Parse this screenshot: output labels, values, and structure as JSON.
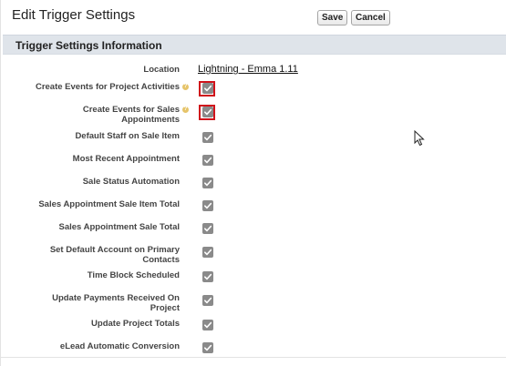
{
  "header": {
    "title": "Edit Trigger Settings",
    "save_label": "Save",
    "cancel_label": "Cancel"
  },
  "section": {
    "title": "Trigger Settings Information"
  },
  "location": {
    "label": "Location",
    "value": "Lightning - Emma 1.11"
  },
  "settings": [
    {
      "line1": "Create Events for Project Activities",
      "line2": "",
      "checked": true,
      "help": true,
      "highlighted": true
    },
    {
      "line1": "Create Events for Sales",
      "line2": "Appointments",
      "checked": true,
      "help": true,
      "highlighted": true
    },
    {
      "line1": "Default Staff on Sale Item",
      "line2": "",
      "checked": true,
      "help": false,
      "highlighted": false
    },
    {
      "line1": "Most Recent Appointment",
      "line2": "",
      "checked": true,
      "help": false,
      "highlighted": false
    },
    {
      "line1": "Sale Status Automation",
      "line2": "",
      "checked": true,
      "help": false,
      "highlighted": false
    },
    {
      "line1": "Sales Appointment Sale Item Total",
      "line2": "",
      "checked": true,
      "help": false,
      "highlighted": false
    },
    {
      "line1": "Sales Appointment Sale Total",
      "line2": "",
      "checked": true,
      "help": false,
      "highlighted": false
    },
    {
      "line1": "Set Default Account on Primary",
      "line2": "Contacts",
      "checked": true,
      "help": false,
      "highlighted": false
    },
    {
      "line1": "Time Block Scheduled",
      "line2": "",
      "checked": true,
      "help": false,
      "highlighted": false
    },
    {
      "line1": "Update Payments Received On",
      "line2": "Project",
      "checked": true,
      "help": false,
      "highlighted": false
    },
    {
      "line1": "Update Project Totals",
      "line2": "",
      "checked": true,
      "help": false,
      "highlighted": false
    },
    {
      "line1": "eLead Automatic Conversion",
      "line2": "",
      "checked": true,
      "help": false,
      "highlighted": false
    }
  ],
  "colors": {
    "highlight": "#d0131b",
    "checkbox": "#8a8a8a",
    "section_bg": "#dfe4ea"
  }
}
